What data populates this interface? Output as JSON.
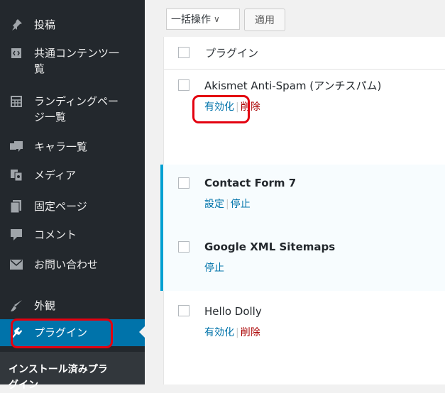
{
  "sidebar": {
    "items": [
      {
        "label": "投稿",
        "icon": "pin-icon"
      },
      {
        "label": "共通コンテンツ一\n覧",
        "icon": "code-icon"
      },
      {
        "label": "ランディングペー\nジ一覧",
        "icon": "grid-icon"
      },
      {
        "label": "キャラ一覧",
        "icon": "chat-icon"
      },
      {
        "label": "メディア",
        "icon": "media-icon"
      },
      {
        "label": "固定ページ",
        "icon": "page-icon"
      },
      {
        "label": "コメント",
        "icon": "comment-icon"
      },
      {
        "label": "お問い合わせ",
        "icon": "mail-icon"
      },
      {
        "label": "外観",
        "icon": "brush-icon"
      },
      {
        "label": "プラグイン",
        "icon": "plugin-icon"
      }
    ],
    "submenu_label": "インストール済みプラ\nグイン"
  },
  "toolbar": {
    "bulk_action": "一括操作",
    "apply": "適用"
  },
  "table": {
    "column_title": "プラグイン",
    "rows": [
      {
        "name": "Akismet Anti-Spam (アンチスパム)",
        "actions": [
          "有効化",
          "削除"
        ]
      },
      {
        "name": "Contact Form 7",
        "actions": [
          "設定",
          "停止"
        ]
      },
      {
        "name": "Google XML Sitemaps",
        "actions": [
          "停止"
        ]
      },
      {
        "name": "Hello Dolly",
        "actions": [
          "有効化",
          "削除"
        ]
      }
    ]
  },
  "colors": {
    "sidebar_bg": "#23282d",
    "accent": "#0073aa",
    "active_border": "#00a0d2",
    "highlight": "#e3000f",
    "delete": "#a00"
  }
}
